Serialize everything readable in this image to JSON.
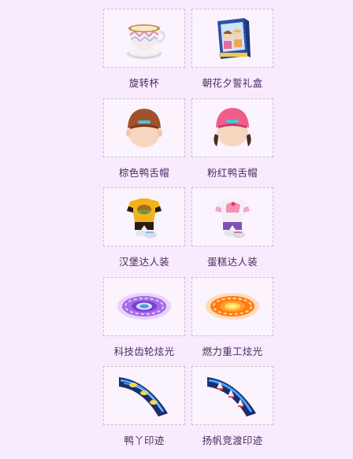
{
  "items": [
    {
      "name": "旋转杯",
      "icon": "teacup-icon"
    },
    {
      "name": "朝花夕誓礼盒",
      "icon": "gift-box-icon"
    },
    {
      "name": "棕色鸭舌帽",
      "icon": "brown-cap-icon"
    },
    {
      "name": "粉红鸭舌帽",
      "icon": "pink-cap-icon"
    },
    {
      "name": "汉堡达人装",
      "icon": "burger-outfit-icon"
    },
    {
      "name": "蛋糕达人装",
      "icon": "cake-outfit-icon"
    },
    {
      "name": "科技齿轮炫光",
      "icon": "purple-gear-glow-icon"
    },
    {
      "name": "燃力重工炫光",
      "icon": "orange-gear-glow-icon"
    },
    {
      "name": "鸭丫印迹",
      "icon": "duck-trail-icon"
    },
    {
      "name": "扬帆竞渡印迹",
      "icon": "sail-trail-icon"
    }
  ],
  "colors": {
    "background": "#f8ebfd",
    "label": "#4a2a5e",
    "frame_border": "#c7bccf"
  }
}
